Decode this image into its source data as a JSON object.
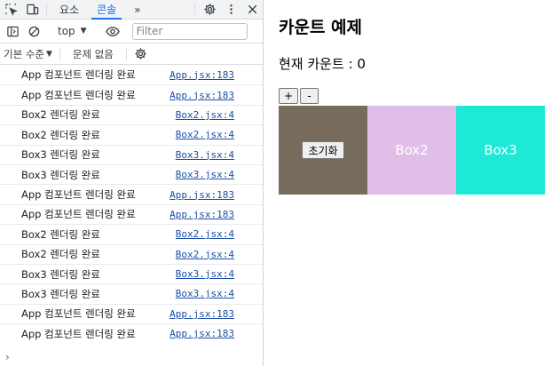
{
  "devtools": {
    "tabs": [
      {
        "label": "요소"
      },
      {
        "label": "콘솔"
      }
    ],
    "more_tabs_label": "»",
    "toolbar": {
      "context": "top",
      "filter_placeholder": "Filter"
    },
    "levels": {
      "level_label": "기본 수준",
      "issues_label": "문제 없음"
    },
    "messages": [
      {
        "text": "App 컴포넌트 렌더링 완료",
        "source": "App.jsx:183"
      },
      {
        "text": "App 컴포넌트 렌더링 완료",
        "source": "App.jsx:183"
      },
      {
        "text": "Box2 렌더링 완료",
        "source": "Box2.jsx:4"
      },
      {
        "text": "Box2 렌더링 완료",
        "source": "Box2.jsx:4"
      },
      {
        "text": "Box3 렌더링 완료",
        "source": "Box3.jsx:4"
      },
      {
        "text": "Box3 렌더링 완료",
        "source": "Box3.jsx:4"
      },
      {
        "text": "App 컴포넌트 렌더링 완료",
        "source": "App.jsx:183"
      },
      {
        "text": "App 컴포넌트 렌더링 완료",
        "source": "App.jsx:183"
      },
      {
        "text": "Box2 렌더링 완료",
        "source": "Box2.jsx:4"
      },
      {
        "text": "Box2 렌더링 완료",
        "source": "Box2.jsx:4"
      },
      {
        "text": "Box3 렌더링 완료",
        "source": "Box3.jsx:4"
      },
      {
        "text": "Box3 렌더링 완료",
        "source": "Box3.jsx:4"
      },
      {
        "text": "App 컴포넌트 렌더링 완료",
        "source": "App.jsx:183"
      },
      {
        "text": "App 컴포넌트 렌더링 완료",
        "source": "App.jsx:183"
      }
    ],
    "prompt_symbol": "›"
  },
  "page": {
    "title": "카운트 예제",
    "count_text": "현재 카운트 : 0",
    "plus_label": "+",
    "minus_label": "-",
    "reset_label": "초기화",
    "box2_label": "Box2",
    "box3_label": "Box3",
    "colors": {
      "box1": "#776b5d",
      "box2": "#e1bee7",
      "box3": "#1de9d6"
    }
  },
  "accent": "#1a73e8"
}
